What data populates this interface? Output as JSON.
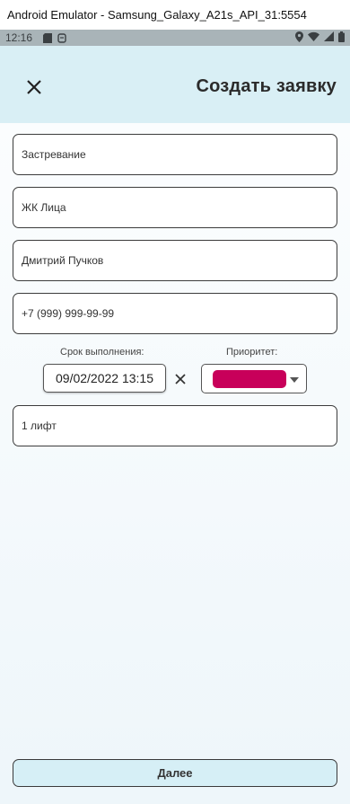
{
  "window_title": "Android Emulator - Samsung_Galaxy_A21s_API_31:5554",
  "statusbar": {
    "time": "12:16"
  },
  "header": {
    "title": "Создать заявку"
  },
  "form": {
    "problem": "Застревание",
    "address": "ЖК Лица",
    "contact_name": "Дмитрий Пучков",
    "phone": "+7 (999) 999-99-99",
    "deadline_label": "Срок выполнения:",
    "deadline_value": "09/02/2022 13:15",
    "priority_label": "Приоритет:",
    "priority_color": "#c8005a",
    "object": "1 лифт"
  },
  "footer": {
    "next_label": "Далее"
  }
}
